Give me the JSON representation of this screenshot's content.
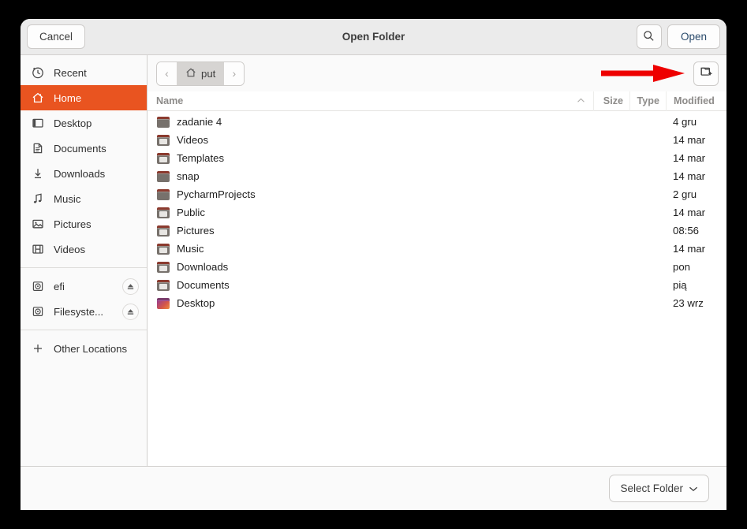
{
  "window": {
    "title": "Open Folder"
  },
  "header": {
    "cancel_label": "Cancel",
    "title": "Open Folder",
    "search_icon": "search-icon",
    "open_label": "Open"
  },
  "pathbar": {
    "back_icon": "chevron-left-icon",
    "forward_icon": "chevron-right-icon",
    "home_icon": "home-icon",
    "current_crumb": "put",
    "new_folder_icon": "new-folder-icon"
  },
  "sidebar": {
    "items": [
      {
        "label": "Recent",
        "icon": "clock-icon",
        "selected": false,
        "eject": false
      },
      {
        "label": "Home",
        "icon": "home-icon",
        "selected": true,
        "eject": false
      },
      {
        "label": "Desktop",
        "icon": "desktop-icon",
        "selected": false,
        "eject": false
      },
      {
        "label": "Documents",
        "icon": "document-icon",
        "selected": false,
        "eject": false
      },
      {
        "label": "Downloads",
        "icon": "download-icon",
        "selected": false,
        "eject": false
      },
      {
        "label": "Music",
        "icon": "music-note-icon",
        "selected": false,
        "eject": false
      },
      {
        "label": "Pictures",
        "icon": "image-icon",
        "selected": false,
        "eject": false
      },
      {
        "label": "Videos",
        "icon": "film-icon",
        "selected": false,
        "eject": false
      }
    ],
    "devices": [
      {
        "label": "efi",
        "icon": "disk-icon",
        "eject": true
      },
      {
        "label": "Filesyste...",
        "icon": "disk-icon",
        "eject": true
      }
    ],
    "other_locations": {
      "label": "Other Locations",
      "icon": "plus-icon"
    }
  },
  "columns": {
    "name": "Name",
    "size": "Size",
    "type": "Type",
    "modified": "Modified",
    "sort_indicator": "sort-ascending-icon"
  },
  "files": [
    {
      "name": "zadanie 4",
      "size": "",
      "type": "",
      "modified": "4 gru",
      "icon": "folder-plain"
    },
    {
      "name": "Videos",
      "size": "",
      "type": "",
      "modified": "14 mar",
      "icon": "folder-videos"
    },
    {
      "name": "Templates",
      "size": "",
      "type": "",
      "modified": "14 mar",
      "icon": "folder-templates"
    },
    {
      "name": "snap",
      "size": "",
      "type": "",
      "modified": "14 mar",
      "icon": "folder-plain"
    },
    {
      "name": "PycharmProjects",
      "size": "",
      "type": "",
      "modified": "2 gru",
      "icon": "folder-plain"
    },
    {
      "name": "Public",
      "size": "",
      "type": "",
      "modified": "14 mar",
      "icon": "folder-public"
    },
    {
      "name": "Pictures",
      "size": "",
      "type": "",
      "modified": "08:56",
      "icon": "folder-pictures"
    },
    {
      "name": "Music",
      "size": "",
      "type": "",
      "modified": "14 mar",
      "icon": "folder-music"
    },
    {
      "name": "Downloads",
      "size": "",
      "type": "",
      "modified": "pon",
      "icon": "folder-downloads"
    },
    {
      "name": "Documents",
      "size": "",
      "type": "",
      "modified": "pią",
      "icon": "folder-documents"
    },
    {
      "name": "Desktop",
      "size": "",
      "type": "",
      "modified": "23 wrz",
      "icon": "folder-desktop"
    }
  ],
  "bottom": {
    "select_folder_label": "Select Folder",
    "dropdown_icon": "chevron-down-icon"
  },
  "annotation": {
    "arrow_icon": "red-arrow-pointing-right",
    "color": "#ee0000"
  },
  "colors": {
    "accent": "#e95420",
    "headerbar": "#ebebeb",
    "sidebar": "#fafafa",
    "list_background": "#ffffff",
    "open_label": "#2a4a6b"
  }
}
